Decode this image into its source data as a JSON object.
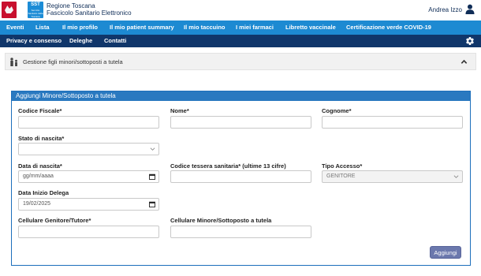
{
  "header": {
    "logo_region": "regione-toscana-logo",
    "logo_sst": {
      "main": "SST",
      "sub": "Servizio Sanitario della Toscana"
    },
    "brand_line1": "Regione Toscana",
    "brand_line2": "Fascicolo Sanitario Elettronico",
    "user_name": "Andrea Izzo",
    "user_icon": "user-icon"
  },
  "nav_primary": [
    {
      "label": "Eventi",
      "active": true
    },
    {
      "label": "Lista",
      "active": true
    },
    {
      "label": "Il mio profilo",
      "active": false
    },
    {
      "label": "Il mio patient summary",
      "active": false
    },
    {
      "label": "Il mio taccuino",
      "active": false
    },
    {
      "label": "I miei farmaci",
      "active": false
    },
    {
      "label": "Libretto vaccinale",
      "active": false
    },
    {
      "label": "Certificazione verde COVID-19",
      "active": false
    }
  ],
  "nav_secondary": [
    {
      "label": "Privacy e consenso"
    },
    {
      "label": "Deleghe"
    },
    {
      "label": "Contatti"
    }
  ],
  "settings_icon": "gear-icon",
  "panel": {
    "title": "Gestione figli minori/sottoposti a tutela",
    "icon": "family-icon",
    "toggle_icon": "chevron-up-icon"
  },
  "form": {
    "title": "Aggiungi Minore/Sottoposto a tutela",
    "fields": {
      "codice_fiscale": {
        "label": "Codice Fiscale*",
        "value": ""
      },
      "nome": {
        "label": "Nome*",
        "value": ""
      },
      "cognome": {
        "label": "Cognome*",
        "value": ""
      },
      "stato_nascita": {
        "label": "Stato di nascita*",
        "value": ""
      },
      "data_nascita": {
        "label": "Data di nascita*",
        "placeholder": "gg/mm/aaaa"
      },
      "codice_tessera": {
        "label": "Codice tessera sanitaria* (ultime 13 cifre)",
        "value": ""
      },
      "tipo_accesso": {
        "label": "Tipo Accesso*",
        "value": "GENITORE"
      },
      "data_inizio_delega": {
        "label": "Data Inizio Delega",
        "value": "19/02/2025"
      },
      "cellulare_genitore": {
        "label": "Cellulare Genitore/Tutore*",
        "value": ""
      },
      "cellulare_minore": {
        "label": "Cellulare Minore/Sottoposto a tutela",
        "value": ""
      }
    },
    "submit_label": "Aggiungi"
  },
  "colors": {
    "nav_primary_bg": "#1d8ad2",
    "nav_secondary_bg": "#10366a",
    "active_nav_text": "#f2e33b",
    "form_header_bg": "#2a79c0",
    "submit_button_bg": "#6b78ad"
  }
}
